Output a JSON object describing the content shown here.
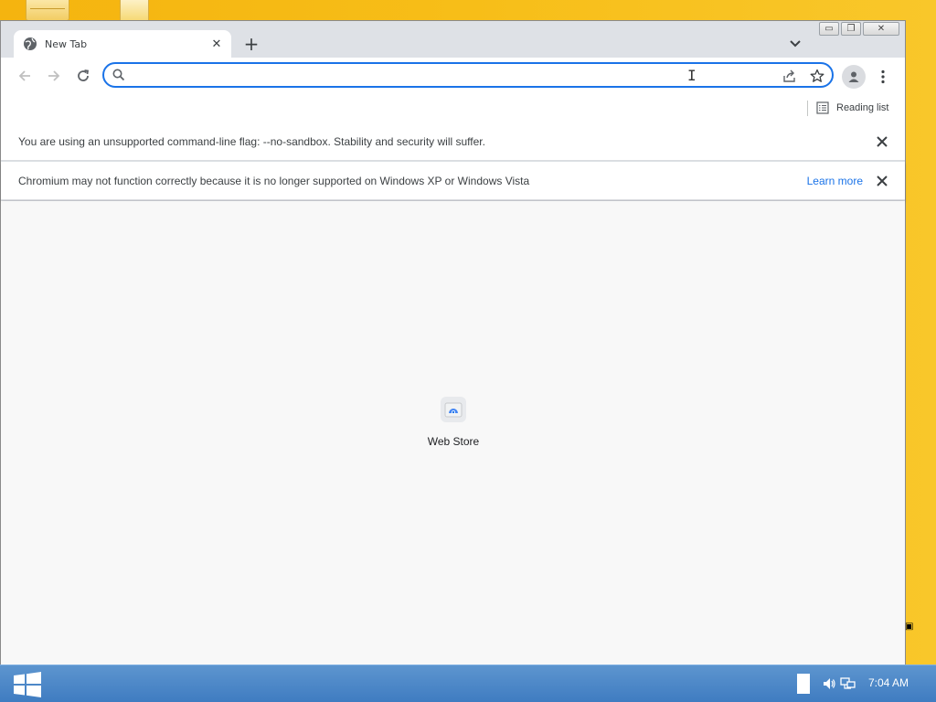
{
  "browser": {
    "tab": {
      "title": "New Tab",
      "icon": "globe-icon",
      "close_icon": "close-icon"
    },
    "new_tab_icon": "plus-icon",
    "tab_search_icon": "chevron-down-icon",
    "window_controls": [
      "minimize-icon",
      "maximize-icon",
      "close-icon"
    ],
    "toolbar": {
      "back_icon": "arrow-left-icon",
      "forward_icon": "arrow-right-icon",
      "reload_icon": "reload-icon",
      "omnibox": {
        "value": "",
        "placeholder": "",
        "search_icon": "search-icon",
        "share_icon": "share-icon",
        "bookmark_icon": "star-icon"
      },
      "profile_icon": "profile-icon",
      "menu_icon": "kebab-menu-icon"
    },
    "bookmarks_bar": {
      "reading_list_label": "Reading list",
      "reading_list_icon": "list-icon"
    },
    "infobars": [
      {
        "message": "You are using an unsupported command-line flag: --no-sandbox. Stability and security will suffer."
      },
      {
        "message": "Chromium may not function correctly because it is no longer supported on Windows XP or Windows Vista",
        "link": "Learn more"
      }
    ],
    "new_tab_page": {
      "shortcut_label": "Web Store",
      "shortcut_icon": "web-store-icon"
    }
  },
  "taskbar": {
    "start_icon": "windows-logo-icon",
    "clock": "7:04 AM",
    "tray_icons": [
      "speaker-icon",
      "network-icon"
    ]
  },
  "colors": {
    "accent": "#1a73e8",
    "desktop": "#f7be18",
    "taskbar": "#4a86c8",
    "tabstrip": "#dee1e6"
  }
}
